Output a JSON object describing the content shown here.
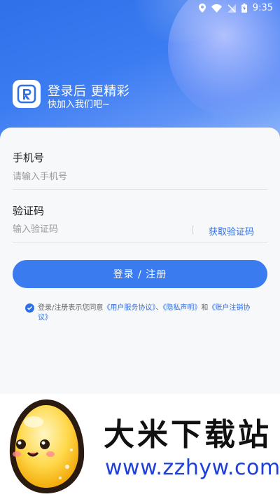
{
  "status_bar": {
    "time": "9:35",
    "icons": [
      "location-icon",
      "wifi-icon",
      "no-signal-icon",
      "battery-icon"
    ]
  },
  "header": {
    "logo_letter": "R",
    "headline": "登录后 更精彩",
    "subline": "快加入我们吧~"
  },
  "form": {
    "phone": {
      "label": "手机号",
      "placeholder": "请输入手机号",
      "value": ""
    },
    "code": {
      "label": "验证码",
      "placeholder": "输入验证码",
      "value": "",
      "get_code_label": "获取验证码"
    },
    "submit_label": "登录 / 注册"
  },
  "agreement": {
    "checked": true,
    "prefix": "登录/注册表示您同意",
    "user_agreement": "《用户服务协议》",
    "sep1": "、",
    "privacy": "《隐私声明》",
    "and": "和",
    "cancel_agreement": "《账户注销协议》"
  },
  "watermark": {
    "title": "大米下载站",
    "url": "www.zzhyw.com"
  },
  "colors": {
    "accent": "#3a7bf0",
    "link": "#2e6fe6",
    "hero_start": "#2f6fe8"
  }
}
